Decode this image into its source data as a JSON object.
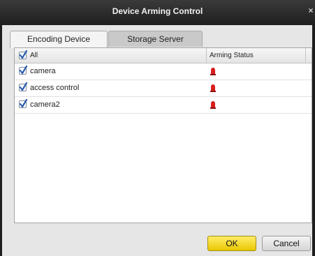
{
  "window": {
    "title": "Device Arming Control",
    "close_glyph": "×"
  },
  "tabs": [
    {
      "label": "Encoding Device",
      "selected": true
    },
    {
      "label": "Storage Server",
      "selected": false
    }
  ],
  "table": {
    "header": {
      "name": "All",
      "status": "Arming Status",
      "checked": true
    },
    "rows": [
      {
        "name": "camera",
        "checked": true,
        "status_icon": "alarm-icon"
      },
      {
        "name": "access control",
        "checked": true,
        "status_icon": "alarm-icon"
      },
      {
        "name": "camera2",
        "checked": true,
        "status_icon": "alarm-icon"
      }
    ]
  },
  "buttons": {
    "ok": "OK",
    "cancel": "Cancel"
  },
  "colors": {
    "titlebar": "#2b2b2b",
    "ok_button": "#f7dc24",
    "alarm": "#d81f1f",
    "checkmark": "#2a5db0"
  }
}
